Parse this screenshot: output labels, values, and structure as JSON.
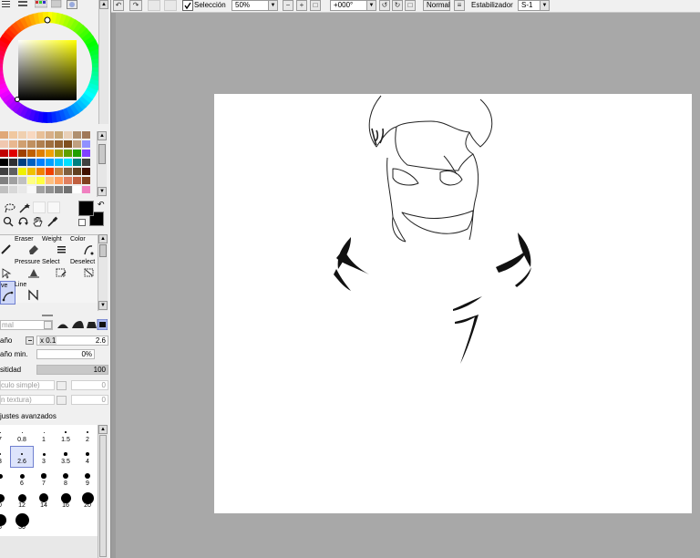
{
  "toolbar": {
    "selection_checkbox_label": "Selección",
    "zoom_value": "50%",
    "rotation_value": "+000°",
    "blend_mode": "Normal",
    "stabilizer_label": "Estabilizador",
    "stabilizer_value": "S-1"
  },
  "colors": {
    "primary": "#000000",
    "secondary": "#000000",
    "picker_hue": "#ffff00"
  },
  "palette": [
    [
      "#e0a878",
      "#f0c8a0",
      "#f0d0b0",
      "#f8d8c0",
      "#e8c098",
      "#d8b088",
      "#c8a878",
      "#e8d0b8",
      "#b09070",
      "#a07858",
      "#f0e8e0",
      "#f0f0f0"
    ],
    [
      "#f0c8b0",
      "#e8b890",
      "#d0a070",
      "#c09060",
      "#b08050",
      "#a07040",
      "#906030",
      "#805020",
      "#c0a080",
      "#9090ff",
      "#30a0ff",
      "#40c0f0"
    ],
    [
      "#c00000",
      "#e00000",
      "#a04000",
      "#c06000",
      "#e08000",
      "#f0a000",
      "#a0a000",
      "#60a000",
      "#20a000",
      "#8040ff",
      "#ff40ff",
      "#ff0080"
    ],
    [
      "#000000",
      "#303030",
      "#004080",
      "#0060c0",
      "#0080ff",
      "#00a0ff",
      "#00c0ff",
      "#00e0ff",
      "#008080",
      "#404040",
      "#202020",
      "#101010"
    ],
    [
      "#404040",
      "#606060",
      "#f0f000",
      "#f0c000",
      "#f08000",
      "#f04000",
      "#c08040",
      "#806040",
      "#604020",
      "#401000",
      "#800000",
      "#a00000"
    ],
    [
      "#808080",
      "#a0a0a0",
      "#c0c0c0",
      "#ffff80",
      "#ffff40",
      "#ffc080",
      "#ffa060",
      "#e08060",
      "#c06040",
      "#804020",
      "#a06080",
      "#c080a0"
    ],
    [
      "#c0c0c0",
      "#d8d8d8",
      "#e8e8e8",
      "#f8f8f8",
      "#a0a0a0",
      "#909090",
      "#808080",
      "#707070",
      "#ffffff",
      "#f080c0",
      "#e060a0",
      "#c04080"
    ]
  ],
  "tools": {
    "row1": [
      "",
      "Eraser",
      "Weight",
      "Color"
    ],
    "row2": [
      "",
      "Pressure",
      "Select",
      "Deselect"
    ],
    "row3": [
      "ve",
      "Line"
    ]
  },
  "brush_props": {
    "blend_mode": "mal",
    "size_label": "año",
    "size_multiplier": "x 0.1",
    "size_value": "2.6",
    "min_size_label": "año min.",
    "min_size_value": "0%",
    "density_label": "sitidad",
    "density_value": "100",
    "shape_select": "culo simple)",
    "shape_value": "0",
    "texture_select": "n textura)",
    "texture_value": "0",
    "advanced_label": "justes avanzados"
  },
  "brush_sizes": [
    [
      "7",
      "0.8",
      "1",
      "1.5",
      "2"
    ],
    [
      "3",
      "2.6",
      "3",
      "3.5",
      "4"
    ],
    [
      "",
      "6",
      "7",
      "8",
      "9"
    ],
    [
      "0",
      "12",
      "14",
      "16",
      "20"
    ],
    [
      "5",
      "30"
    ]
  ]
}
